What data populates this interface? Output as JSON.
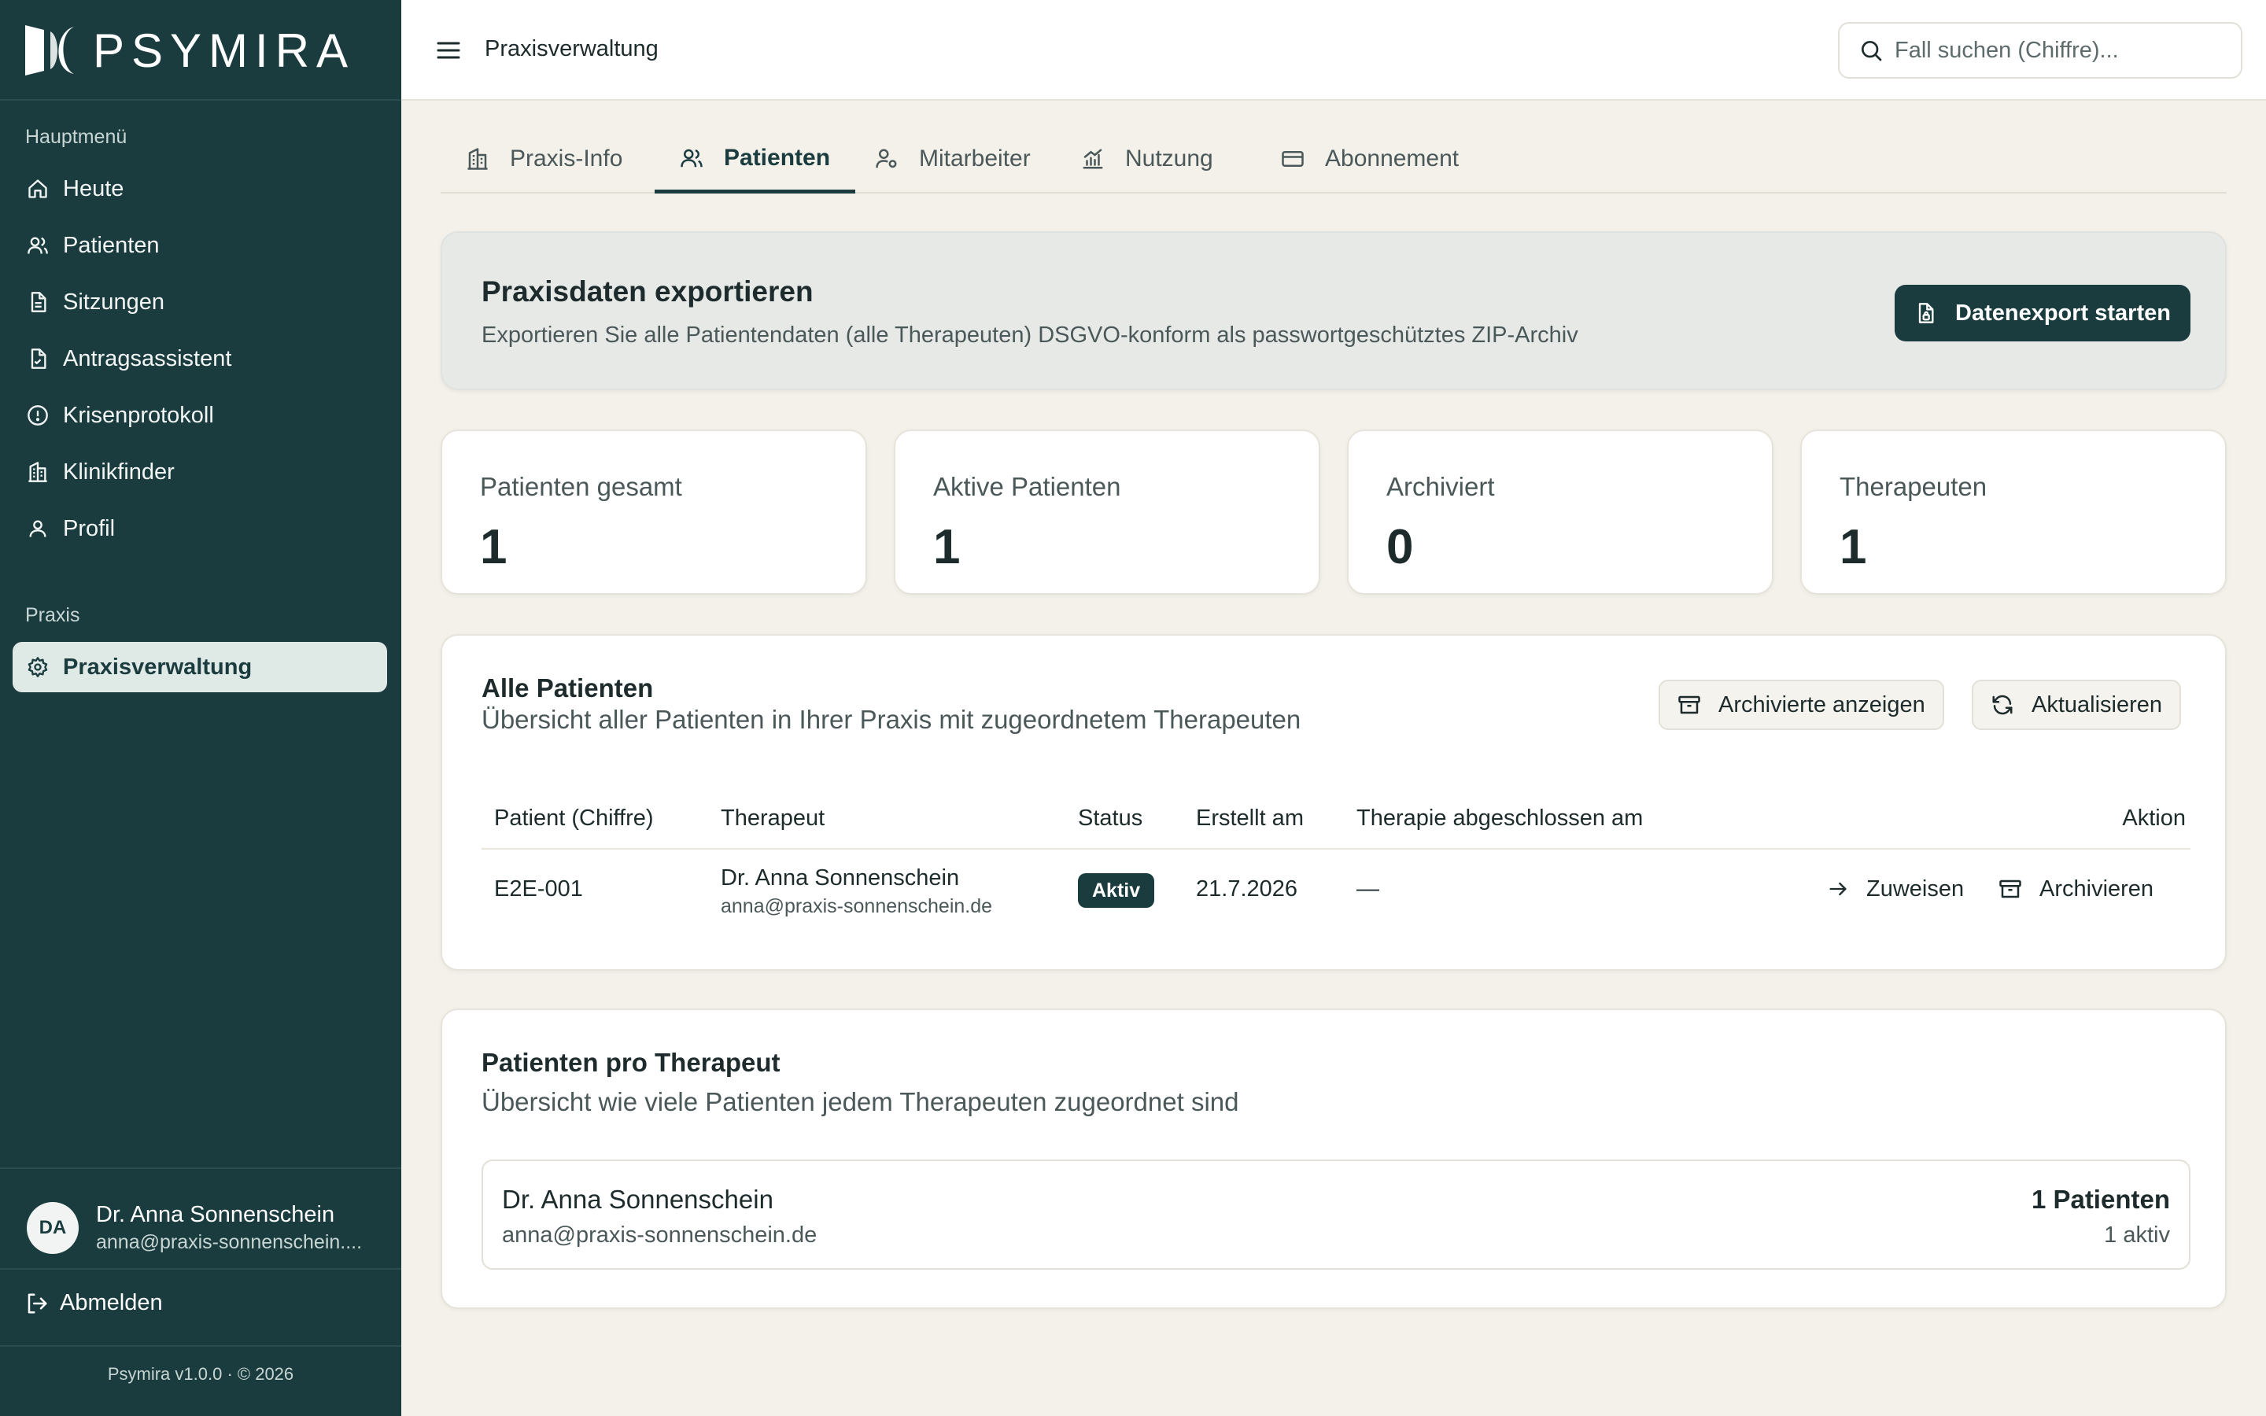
{
  "app": {
    "name": "PSYMIRA"
  },
  "sidebar": {
    "main_section": "Hauptmenü",
    "items": [
      {
        "label": "Heute",
        "icon": "home-icon"
      },
      {
        "label": "Patienten",
        "icon": "users-icon"
      },
      {
        "label": "Sitzungen",
        "icon": "document-icon"
      },
      {
        "label": "Antragsassistent",
        "icon": "file-check-icon"
      },
      {
        "label": "Krisenprotokoll",
        "icon": "alert-circle-icon"
      },
      {
        "label": "Klinikfinder",
        "icon": "building-icon"
      },
      {
        "label": "Profil",
        "icon": "user-icon"
      }
    ],
    "praxis_section": "Praxis",
    "praxis_item": {
      "label": "Praxisverwaltung",
      "icon": "gear-icon",
      "active": true
    },
    "user": {
      "initials": "DA",
      "name": "Dr. Anna Sonnenschein",
      "email": "anna@praxis-sonnenschein...."
    },
    "logout_label": "Abmelden",
    "version": "Psymira v1.0.0 · © 2026"
  },
  "header": {
    "title": "Praxisverwaltung",
    "search_placeholder": "Fall suchen (Chiffre)..."
  },
  "tabs": [
    {
      "label": "Praxis-Info",
      "icon": "building-icon",
      "active": false
    },
    {
      "label": "Patienten",
      "icon": "users-icon",
      "active": true
    },
    {
      "label": "Mitarbeiter",
      "icon": "user-cog-icon",
      "active": false
    },
    {
      "label": "Nutzung",
      "icon": "chart-icon",
      "active": false
    },
    {
      "label": "Abonnement",
      "icon": "credit-card-icon",
      "active": false
    }
  ],
  "export": {
    "title": "Praxisdaten exportieren",
    "description": "Exportieren Sie alle Patientendaten (alle Therapeuten) DSGVO-konform als passwortgeschütztes ZIP-Archiv",
    "button_label": "Datenexport starten"
  },
  "stats": [
    {
      "label": "Patienten gesamt",
      "value": "1"
    },
    {
      "label": "Aktive Patienten",
      "value": "1"
    },
    {
      "label": "Archiviert",
      "value": "0"
    },
    {
      "label": "Therapeuten",
      "value": "1"
    }
  ],
  "patients": {
    "title": "Alle Patienten",
    "subtitle": "Übersicht aller Patienten in Ihrer Praxis mit zugeordnetem Therapeuten",
    "show_archived_label": "Archivierte anzeigen",
    "refresh_label": "Aktualisieren",
    "columns": [
      "Patient (Chiffre)",
      "Therapeut",
      "Status",
      "Erstellt am",
      "Therapie abgeschlossen am",
      "Aktion"
    ],
    "rows": [
      {
        "chiffre": "E2E-001",
        "therapist_name": "Dr. Anna Sonnenschein",
        "therapist_email": "anna@praxis-sonnenschein.de",
        "status": "Aktiv",
        "created": "21.7.2026",
        "closed": "—",
        "assign_label": "Zuweisen",
        "archive_label": "Archivieren"
      }
    ]
  },
  "per_therapist": {
    "title": "Patienten pro Therapeut",
    "subtitle": "Übersicht wie viele Patienten jedem Therapeuten zugeordnet sind",
    "entries": [
      {
        "name": "Dr. Anna Sonnenschein",
        "email": "anna@praxis-sonnenschein.de",
        "count": "1 Patienten",
        "active": "1 aktiv"
      }
    ]
  },
  "colors": {
    "sidebar_bg": "#1b3c3f",
    "accent": "#1b3c3f",
    "page_bg": "#f3f1ea",
    "active_nav_bg": "#dfe9e5"
  }
}
